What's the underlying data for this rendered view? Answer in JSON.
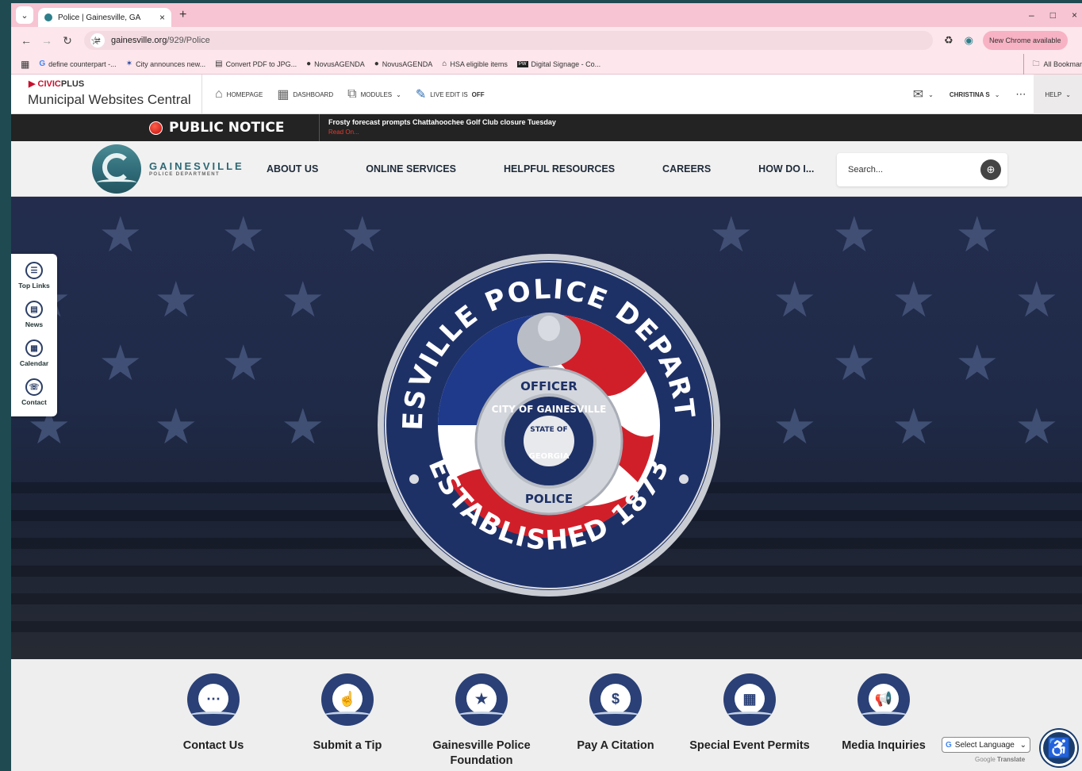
{
  "browser": {
    "tab_title": "Police | Gainesville, GA",
    "url_domain": "gainesville.org",
    "url_path": "/929/Police",
    "new_chrome": "New Chrome available",
    "bookmarks": [
      "define counterpart -...",
      "City announces new...",
      "Convert PDF to JPG...",
      "NovusAGENDA",
      "NovusAGENDA",
      "HSA eligible items",
      "Digital Signage - Co..."
    ],
    "all_bookmarks": "All Bookmar"
  },
  "admin": {
    "brand_civic": "CIVIC",
    "brand_plus": "PLUS",
    "title": "Municipal Websites Central",
    "homepage": "HOMEPAGE",
    "dashboard": "DASHBOARD",
    "modules": "MODULES",
    "live_edit": "LIVE EDIT IS",
    "live_edit_state": "OFF",
    "user": "CHRISTINA S",
    "help": "HELP"
  },
  "notice": {
    "label": "PUBLIC NOTICE",
    "headline": "Frosty forecast prompts Chattahoochee Golf Club closure Tuesday",
    "read_more": "Read On..."
  },
  "site": {
    "logo_name": "GAINESVILLE",
    "logo_sub": "POLICE DEPARTMENT",
    "nav": [
      "ABOUT US",
      "ONLINE SERVICES",
      "HELPFUL RESOURCES",
      "CAREERS",
      "HOW DO I..."
    ],
    "search_placeholder": "Search..."
  },
  "seal": {
    "top": "GAINESVILLE POLICE DEPARTMENT",
    "bottom": "ESTABLISHED 1873",
    "officer": "OFFICER",
    "city": "CITY OF GAINESVILLE",
    "state": "STATE OF",
    "georgia": "GEORGIA",
    "police": "POLICE"
  },
  "sidebar": [
    {
      "label": "Top Links",
      "icon": "list-icon"
    },
    {
      "label": "News",
      "icon": "news-icon"
    },
    {
      "label": "Calendar",
      "icon": "calendar-icon"
    },
    {
      "label": "Contact",
      "icon": "contact-icon"
    }
  ],
  "quick_links": [
    {
      "label": "Contact Us",
      "icon": "chat-icon"
    },
    {
      "label": "Submit a Tip",
      "icon": "tap-icon"
    },
    {
      "label": "Gainesville Police Foundation",
      "icon": "badge-star-icon"
    },
    {
      "label": "Pay A Citation",
      "icon": "receipt-icon"
    },
    {
      "label": "Special Event Permits",
      "icon": "id-card-icon"
    },
    {
      "label": "Media Inquiries",
      "icon": "megaphone-icon"
    }
  ],
  "translate": {
    "select": "Select Language",
    "powered": "Google",
    "translate": "Translate"
  }
}
